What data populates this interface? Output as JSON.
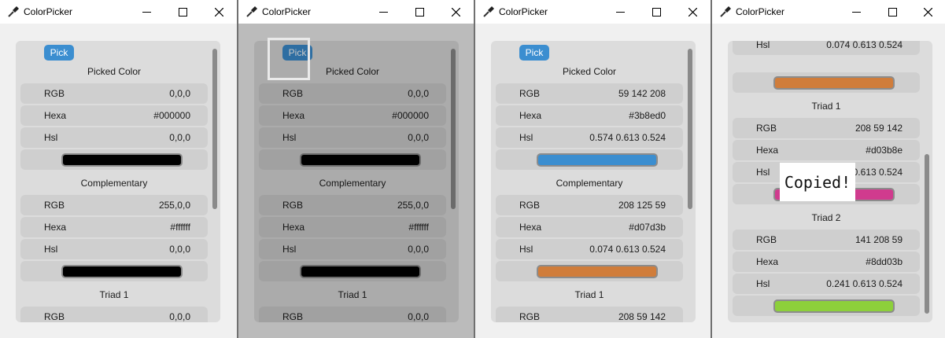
{
  "app": {
    "title": "ColorPicker"
  },
  "pick_label": "Pick",
  "sections": {
    "picked": "Picked Color",
    "complementary": "Complementary",
    "triad1": "Triad 1",
    "triad2": "Triad 2"
  },
  "labels": {
    "rgb": "RGB",
    "hexa": "Hexa",
    "hsl": "Hsl"
  },
  "toast": "Copied!",
  "colors": {
    "accent": "#3b8ed0"
  },
  "windows": [
    {
      "picked": {
        "rgb": "0,0,0",
        "hexa": "#000000",
        "hsl": "0,0,0",
        "swatch": "#000000"
      },
      "complementary": {
        "rgb": "255,0,0",
        "hexa": "#ffffff",
        "hsl": "0,0,0",
        "swatch": "#000000"
      },
      "triad1": {
        "rgb": "0,0,0"
      }
    },
    {
      "picked": {
        "rgb": "0,0,0",
        "hexa": "#000000",
        "hsl": "0,0,0",
        "swatch": "#000000"
      },
      "complementary": {
        "rgb": "255,0,0",
        "hexa": "#ffffff",
        "hsl": "0,0,0",
        "swatch": "#000000"
      },
      "triad1": {
        "rgb": "0,0,0"
      }
    },
    {
      "picked": {
        "rgb": "59 142 208",
        "hexa": "#3b8ed0",
        "hsl": "0.574 0.613 0.524",
        "swatch": "#3b8ed0"
      },
      "complementary": {
        "rgb": "208 125 59",
        "hexa": "#d07d3b",
        "hsl": "0.074 0.613 0.524",
        "swatch": "#d07d3b"
      },
      "triad1": {
        "rgb": "208 59 142"
      }
    },
    {
      "complementary": {
        "hsl": "0.074 0.613 0.524",
        "swatch": "#d07d3b"
      },
      "triad1": {
        "rgb": "208 59 142",
        "hexa": "#d03b8e",
        "hsl": "0.908 0.613 0.524",
        "swatch": "#d03b8e"
      },
      "triad2": {
        "rgb": "141 208 59",
        "hexa": "#8dd03b",
        "hsl": "0.241 0.613 0.524",
        "swatch": "#8dd03b"
      }
    }
  ]
}
